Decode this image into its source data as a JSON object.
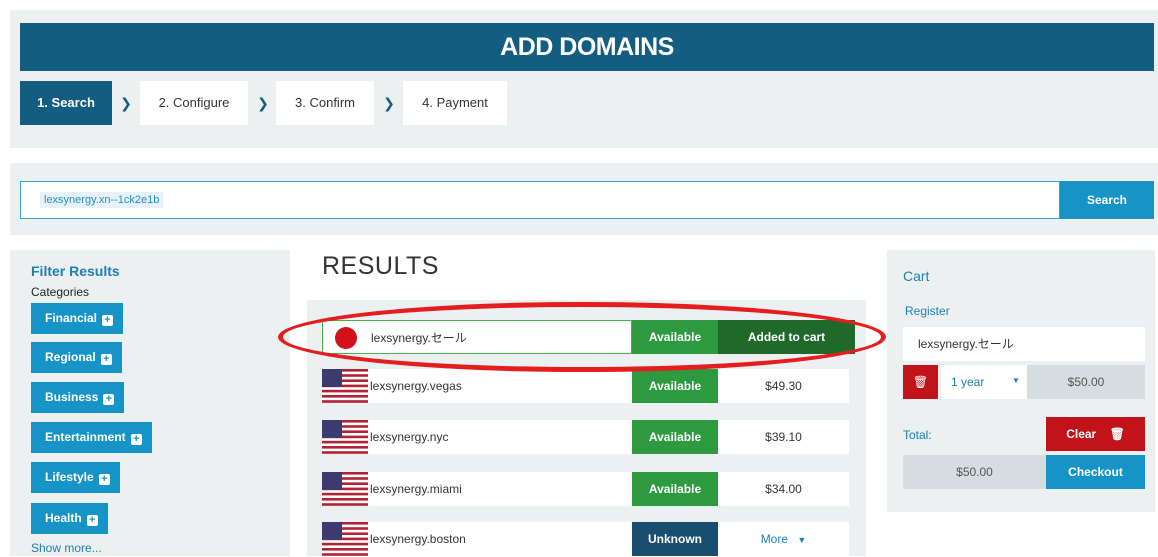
{
  "header": {
    "title": "ADD DOMAINS",
    "steps": [
      {
        "label": "1. Search"
      },
      {
        "label": "2. Configure"
      },
      {
        "label": "3. Confirm"
      },
      {
        "label": "4. Payment"
      }
    ]
  },
  "search": {
    "value": "lexsynergy.xn--1ck2e1b",
    "button_label": "Search"
  },
  "filter": {
    "title": "Filter Results",
    "subtitle": "Categories",
    "categories": [
      "Financial",
      "Regional",
      "Business",
      "Entertainment",
      "Lifestyle",
      "Health"
    ],
    "show_more": "Show more..."
  },
  "results": {
    "title": "RESULTS",
    "rows": [
      {
        "domain": "lexsynergy.セール",
        "flag_icon": "japan-flag-icon",
        "status": "Available",
        "action": "Added to cart"
      },
      {
        "domain": "lexsynergy.vegas",
        "flag_icon": "us-flag-icon",
        "status": "Available",
        "action": "$49.30"
      },
      {
        "domain": "lexsynergy.nyc",
        "flag_icon": "us-flag-icon",
        "status": "Available",
        "action": "$39.10"
      },
      {
        "domain": "lexsynergy.miami",
        "flag_icon": "us-flag-icon",
        "status": "Available",
        "action": "$34.00"
      },
      {
        "domain": "lexsynergy.boston",
        "flag_icon": "us-flag-icon",
        "status": "Unknown",
        "action": "More"
      }
    ]
  },
  "cart": {
    "title": "Cart",
    "register_label": "Register",
    "item_domain": "lexsynergy.セール",
    "term": "1 year",
    "item_price": "$50.00",
    "total_label": "Total:",
    "clear_label": "Clear",
    "total_price": "$50.00",
    "checkout_label": "Checkout"
  },
  "colors": {
    "brand_dark": "#135d80",
    "brand_blue": "#1794c7",
    "available_green": "#2e9a3f",
    "danger_red": "#c0141a",
    "highlight_red": "#e41e1e"
  }
}
